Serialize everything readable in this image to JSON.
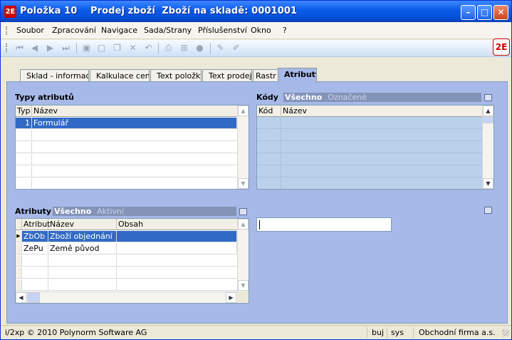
{
  "window": {
    "icon_text": "2E",
    "title": "Položka 10    Prodej zboží  Zboží na skladě: 0001001",
    "minimize": "–",
    "maximize": "□",
    "close": "✕"
  },
  "menu": [
    "Soubor",
    "Zpracování",
    "Navigace",
    "Sada/Strany",
    "Příslušenství",
    "Okno",
    "?"
  ],
  "toolbar": {
    "icons": [
      "first-record-icon",
      "prev-record-icon",
      "next-record-icon",
      "last-record-icon",
      "save-icon",
      "new-icon",
      "copy-icon",
      "delete-icon",
      "undo-icon",
      "print-icon",
      "link-icon",
      "settings-icon",
      "edit-icon",
      "highlight-icon"
    ]
  },
  "tabs": [
    "Sklad - informace",
    "Kalkulace ceny",
    "Text položky",
    "Text prodeje",
    "Rastr",
    "Atributy"
  ],
  "typy_atributu": {
    "label": "Typy atributů",
    "columns": [
      "Typ",
      "Název"
    ],
    "rows": [
      {
        "typ": "1",
        "nazev": "Formulář"
      }
    ]
  },
  "kody": {
    "label": "Kódy",
    "filter_active": "Všechno",
    "filter_inactive": "Označené",
    "columns": [
      "Kód",
      "Název"
    ]
  },
  "atributy": {
    "label": "Atributy",
    "filter_active": "Všechno",
    "filter_inactive": "Aktivní",
    "columns": [
      "Atribut",
      "Název",
      "Obsah"
    ],
    "rows": [
      {
        "atribut": "ZbOb",
        "nazev": "Zboží objednání",
        "obsah": ""
      },
      {
        "atribut": "ZePu",
        "nazev": "Země původ",
        "obsah": ""
      }
    ]
  },
  "status": {
    "copyright": "i/2xp © 2010 Polynorm Software AG",
    "user": "buj",
    "system": "sys",
    "company": "Obchodní firma a.s."
  },
  "colors": {
    "selection": "#316ac5",
    "panel": "#a7b9e8",
    "titlebar": "#0550d8"
  }
}
